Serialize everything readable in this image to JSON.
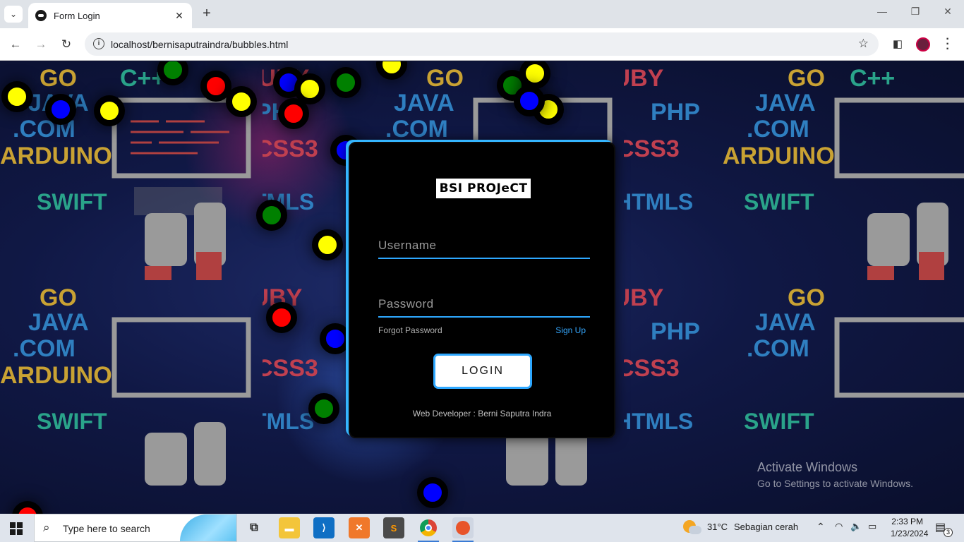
{
  "browser": {
    "tab_title": "Form Login",
    "url": "localhost/bernisaputraindra/bubbles.html"
  },
  "background_words": {
    "go": "GO",
    "cpp": "C++",
    "ruby": "RUBY",
    "java": "JAVA",
    "php": "PHP",
    "com": ".COM",
    "css": "CSS3",
    "arduino": "ARDUINO",
    "swift": "SWIFT",
    "html": "HTMLS"
  },
  "login": {
    "logo_text": "BSI PROJeCT",
    "username_placeholder": "Username",
    "password_placeholder": "Password",
    "forgot_label": "Forgot Password",
    "signup_label": "Sign Up",
    "login_label": "LOGIN",
    "credit": "Web Developer : Berni Saputra Indra"
  },
  "watermark": {
    "title": "Activate Windows",
    "subtitle": "Go to Settings to activate Windows."
  },
  "taskbar": {
    "search_placeholder": "Type here to search",
    "weather_temp": "31°C",
    "weather_text": "Sebagian cerah",
    "time": "2:33 PM",
    "date": "1/23/2024",
    "notification_count": "3"
  },
  "colors": {
    "accent": "#2ea8ff",
    "bubble_yellow": "#ffff00",
    "bubble_blue": "#0000ff",
    "bubble_red": "#ff0000",
    "bubble_green": "#008000"
  }
}
